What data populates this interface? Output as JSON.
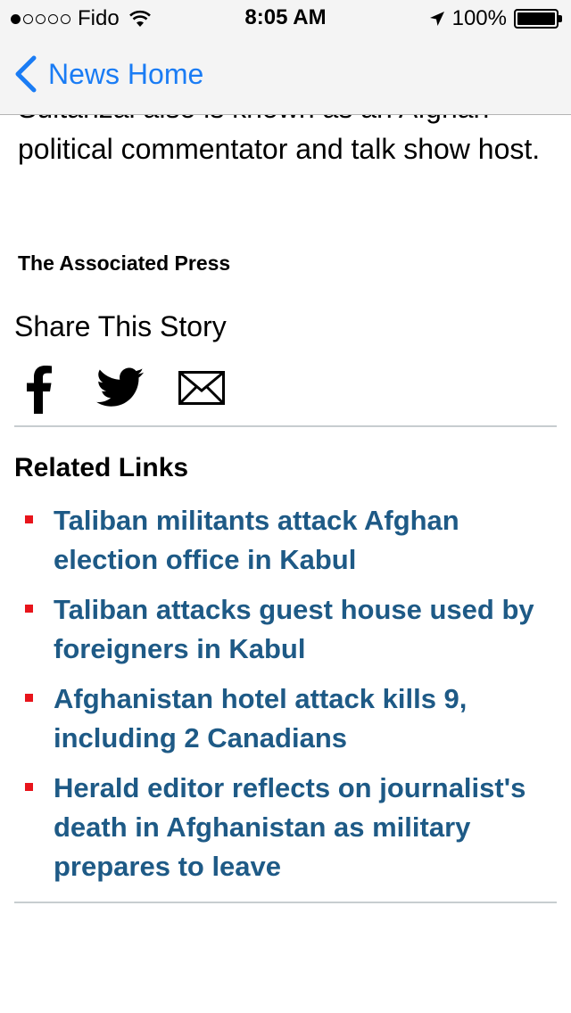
{
  "status_bar": {
    "signal": "●○○○○",
    "carrier": "Fido",
    "time": "8:05 AM",
    "battery_percent": "100%",
    "battery_level": 1.0
  },
  "nav": {
    "back_label": "News Home"
  },
  "article": {
    "partial_hidden_line": "Sultanzai also is known as an Afghan",
    "visible_text": "political commentator and talk show host.",
    "byline": "The Associated Press"
  },
  "share": {
    "title": "Share This Story",
    "icons": [
      "facebook-icon",
      "twitter-icon",
      "email-icon"
    ]
  },
  "related": {
    "title": "Related Links",
    "links": [
      "Taliban militants attack Afghan election office in Kabul",
      "Taliban attacks guest house used by foreigners in Kabul",
      "Afghanistan hotel attack kills 9, including 2 Canadians",
      "Herald editor reflects on journalist's death in Afghanistan as military prepares to leave"
    ]
  },
  "colors": {
    "link": "#1e5a86",
    "bullet": "#e8141b",
    "ios_blue": "#1a7cf4",
    "divider": "#c7cdd0"
  }
}
